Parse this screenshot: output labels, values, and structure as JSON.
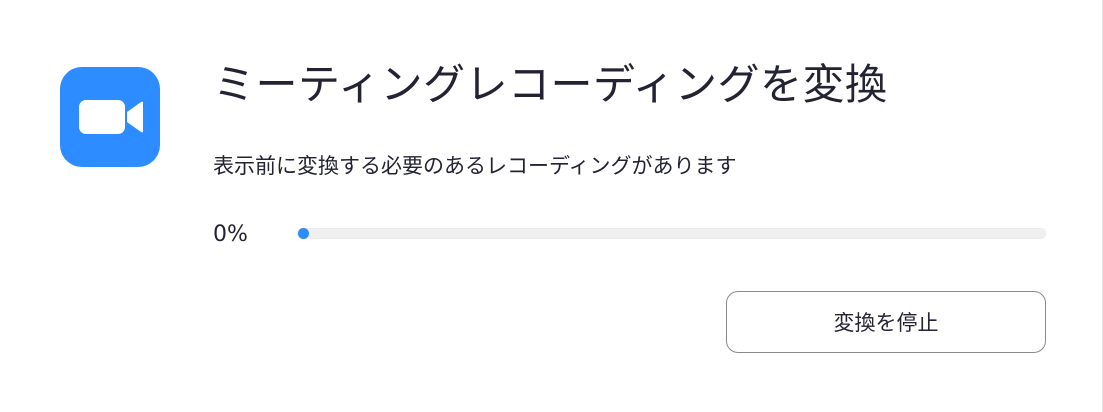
{
  "dialog": {
    "icon": "zoom-video-camera-icon",
    "title": "ミーティングレコーディングを変換",
    "message": "表示前に変換する必要のあるレコーディングがあります",
    "progress": {
      "label": "0%",
      "value": 0
    },
    "stop_button_label": "変換を停止"
  },
  "colors": {
    "accent": "#2d8cff",
    "text": "#232333",
    "track": "#f0f0f0"
  }
}
